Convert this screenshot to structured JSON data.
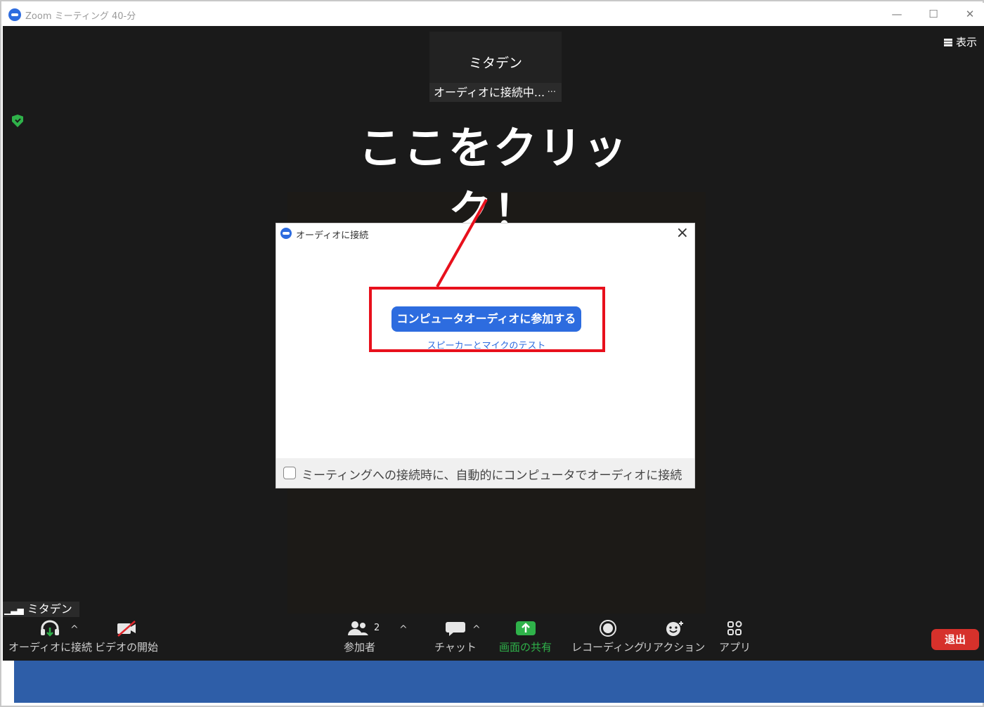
{
  "window": {
    "title": "Zoom ミーティング 40-分",
    "minimize": "—",
    "maximize": "☐",
    "close": "✕"
  },
  "meeting": {
    "view_label": "表示",
    "participant_name": "ミタデン",
    "participant_status": "オーディオに接続中...",
    "tile_more": "···",
    "self_name": "ミタデン"
  },
  "annotation": {
    "headline": "ここをクリック！",
    "accent_color": "#e8101c"
  },
  "dialog": {
    "title": "オーディオに接続",
    "join_button": "コンピュータオーディオに参加する",
    "test_link": "スピーカーとマイクのテスト",
    "auto_connect_label": "ミーティングへの接続時に、自動的にコンピュータでオーディオに接続",
    "auto_connect_checked": false
  },
  "toolbar": {
    "audio": "オーディオに接続",
    "video": "ビデオの開始",
    "participants": "参加者",
    "participants_count": "2",
    "chat": "チャット",
    "share": "画面の共有",
    "record": "レコーディング",
    "reactions": "リアクション",
    "apps": "アプリ",
    "leave": "退出",
    "share_color": "#2fb24a",
    "leave_color": "#d6312b"
  }
}
